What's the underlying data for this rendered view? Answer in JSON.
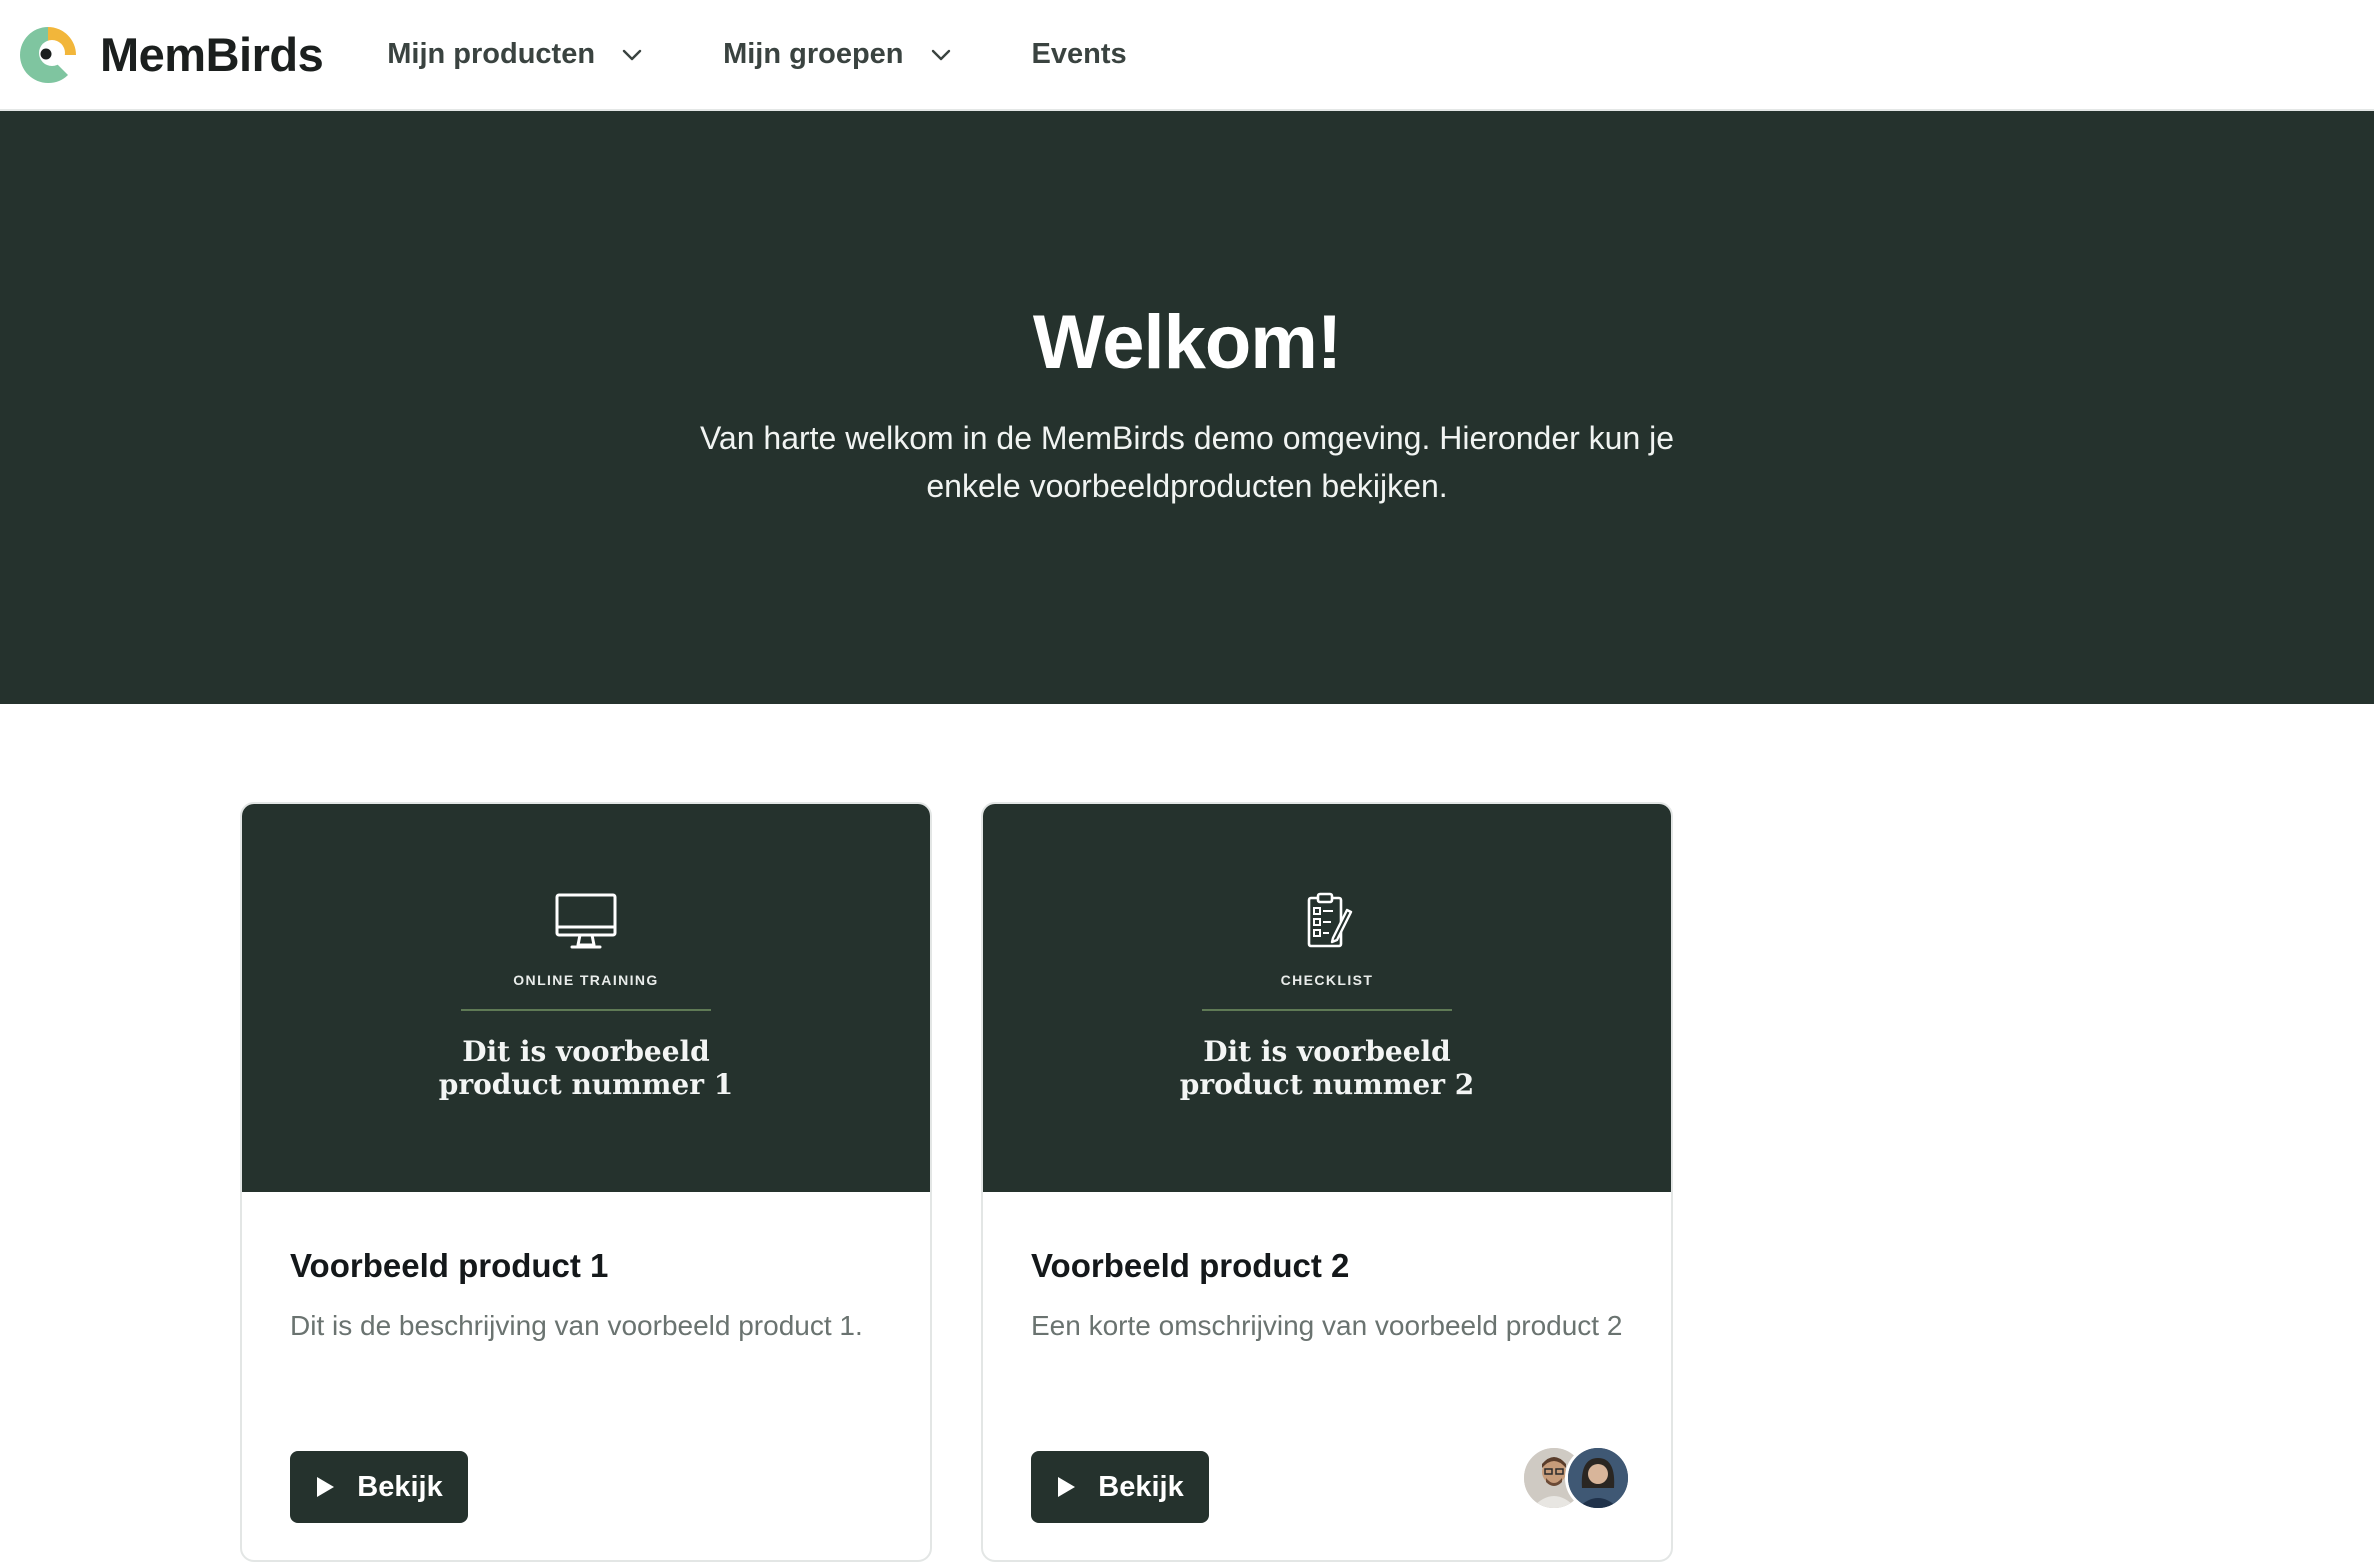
{
  "brand": {
    "name": "MemBirds",
    "logo_icon": "membirds-logo"
  },
  "nav": {
    "items": [
      {
        "label": "Mijn producten",
        "has_dropdown": true
      },
      {
        "label": "Mijn groepen",
        "has_dropdown": true
      },
      {
        "label": "Events",
        "has_dropdown": false
      }
    ]
  },
  "hero": {
    "title": "Welkom!",
    "subtitle": "Van harte welkom in de MemBirds demo omgeving. Hieronder kun je enkele voorbeeldproducten bekijken."
  },
  "products": [
    {
      "cover_icon": "monitor-icon",
      "cover_kicker": "ONLINE TRAINING",
      "cover_title": "Dit is voorbeeld product nummer 1",
      "title": "Voorbeeld product 1",
      "description": "Dit is de beschrijving van voorbeeld product 1.",
      "button_label": "Bekijk",
      "has_avatars": false
    },
    {
      "cover_icon": "clipboard-checklist-icon",
      "cover_kicker": "CHECKLIST",
      "cover_title": "Dit is voorbeeld product nummer 2",
      "title": "Voorbeeld product 2",
      "description": "Een korte omschrijving van voorbeeld product 2",
      "button_label": "Bekijk",
      "has_avatars": true
    }
  ],
  "colors": {
    "primary_dark": "#25322d",
    "accent_green": "#5f7a55",
    "logo_green": "#7fc5a0",
    "logo_yellow": "#f2b63a"
  }
}
